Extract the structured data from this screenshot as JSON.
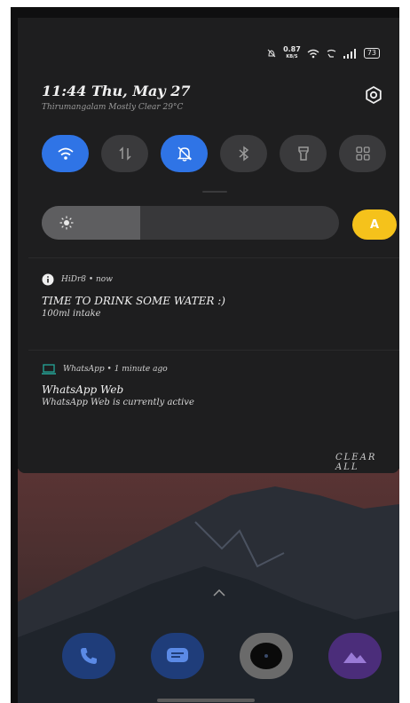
{
  "status_bar": {
    "net_speed": "0.87",
    "net_unit": "KB/S",
    "battery": "73"
  },
  "header": {
    "datetime": "11:44 Thu, May 27",
    "weather": "Thirumangalam Mostly Clear 29°C"
  },
  "quick_tiles": [
    {
      "name": "wifi",
      "active": true
    },
    {
      "name": "mobile-data",
      "active": false
    },
    {
      "name": "do-not-disturb",
      "active": true
    },
    {
      "name": "bluetooth",
      "active": false
    },
    {
      "name": "flashlight",
      "active": false
    },
    {
      "name": "more",
      "active": false
    }
  ],
  "brightness": {
    "level_fraction": 0.33,
    "auto_label": "A"
  },
  "notifications": [
    {
      "app": "HiDr8 • now",
      "title": "TIME TO DRINK SOME WATER :)",
      "body": "100ml intake"
    },
    {
      "app": "WhatsApp • 1 minute ago",
      "title": "WhatsApp Web",
      "body": "WhatsApp Web is currently active"
    }
  ],
  "clear_all": "CLEAR ALL",
  "colors": {
    "accent_blue": "#2f74e6",
    "auto_yellow": "#f5c21b",
    "whatsapp_green": "#25a79a"
  }
}
